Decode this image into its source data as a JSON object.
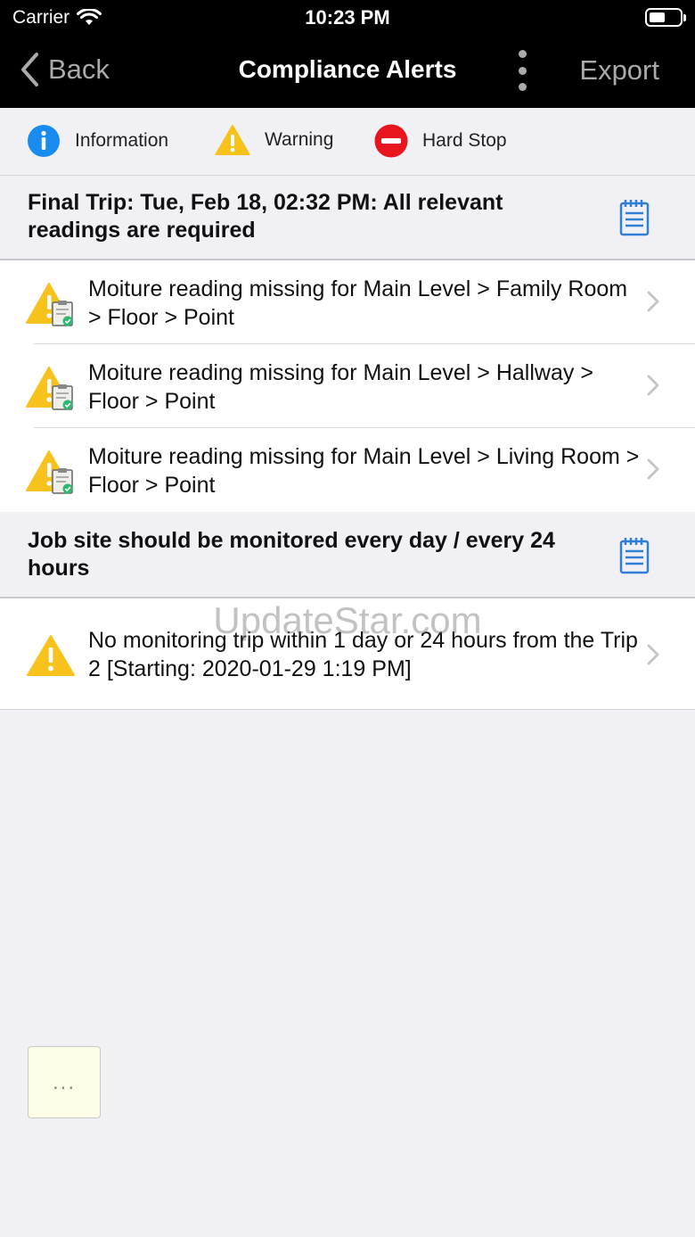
{
  "status_bar": {
    "carrier": "Carrier",
    "time": "10:23 PM"
  },
  "nav": {
    "back_label": "Back",
    "title": "Compliance Alerts",
    "export_label": "Export"
  },
  "legend": [
    {
      "label": "Information",
      "icon": "info-icon",
      "color": "#1a8cf0"
    },
    {
      "label": "Warning",
      "icon": "warning-icon",
      "color": "#f7c21b"
    },
    {
      "label": "Hard Stop",
      "icon": "hard-stop-icon",
      "color": "#e8141e"
    }
  ],
  "sections": [
    {
      "title": "Final Trip: Tue, Feb 18, 02:32 PM: All relevant readings are required",
      "icon": "notepad-icon",
      "alerts": [
        {
          "text": "Moiture reading missing for Main Level > Family Room > Floor > Point",
          "icon": "warning-clipboard-icon"
        },
        {
          "text": "Moiture reading missing for Main Level > Hallway > Floor > Point",
          "icon": "warning-clipboard-icon"
        },
        {
          "text": "Moiture reading missing for Main Level > Living Room > Floor > Point",
          "icon": "warning-clipboard-icon"
        }
      ]
    },
    {
      "title": "Job site should be monitored every day / every 24 hours",
      "icon": "notepad-icon",
      "alerts": [
        {
          "text": "No monitoring trip within 1 day or 24 hours from the Trip 2 [Starting: 2020-01-29 1:19 PM]",
          "icon": "warning-icon"
        }
      ]
    }
  ],
  "watermark": "UpdateStar.com",
  "more_button": {
    "label": "..."
  },
  "colors": {
    "accent_blue": "#2f7fd6",
    "warning_yellow": "#f7c21b",
    "nav_background": "#000000"
  }
}
